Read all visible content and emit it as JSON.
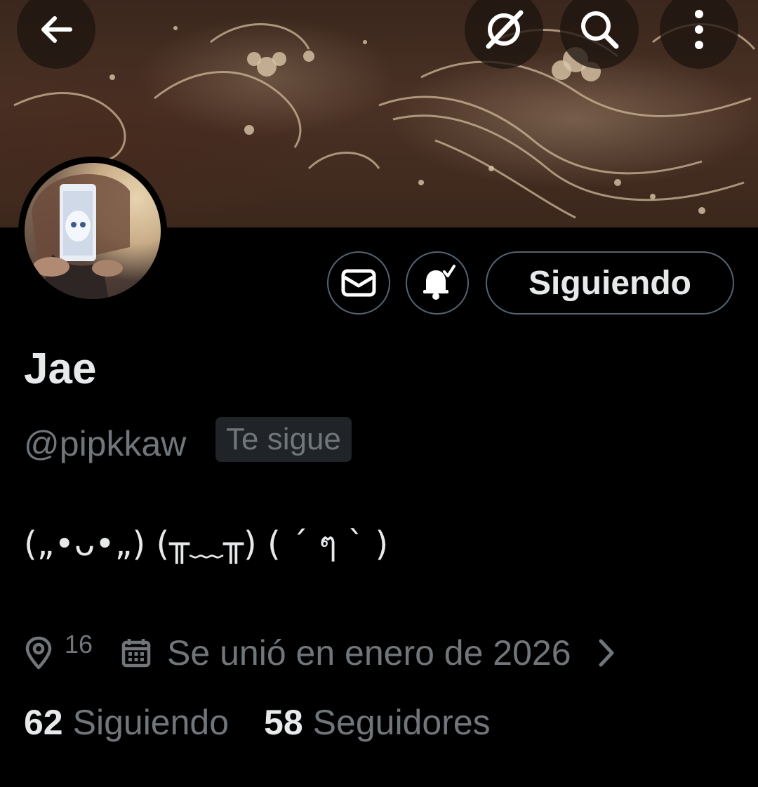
{
  "header": {
    "back_icon": "arrow-left-icon",
    "actions": [
      "grok-icon",
      "search-icon",
      "more-vertical-icon"
    ]
  },
  "profile": {
    "display_name": "Jae",
    "handle": "@pipkkaw",
    "follows_you_badge": "Te sigue",
    "bio": "(„•ᴗ•„) (╥﹏╥) ( ´ ๆ ` )",
    "location": "16",
    "joined": "Se unió en enero de 2026",
    "following_count": "62",
    "following_label": "Siguiendo",
    "followers_count": "58",
    "followers_label": "Seguidores"
  },
  "actions": {
    "message_icon": "mail-icon",
    "notify_icon": "bell-check-icon",
    "follow_button_label": "Siguiendo"
  },
  "colors": {
    "background": "#000000",
    "text_primary": "#e7e9ea",
    "text_secondary": "#71767b",
    "border": "#536471",
    "badge_bg": "#202327"
  }
}
